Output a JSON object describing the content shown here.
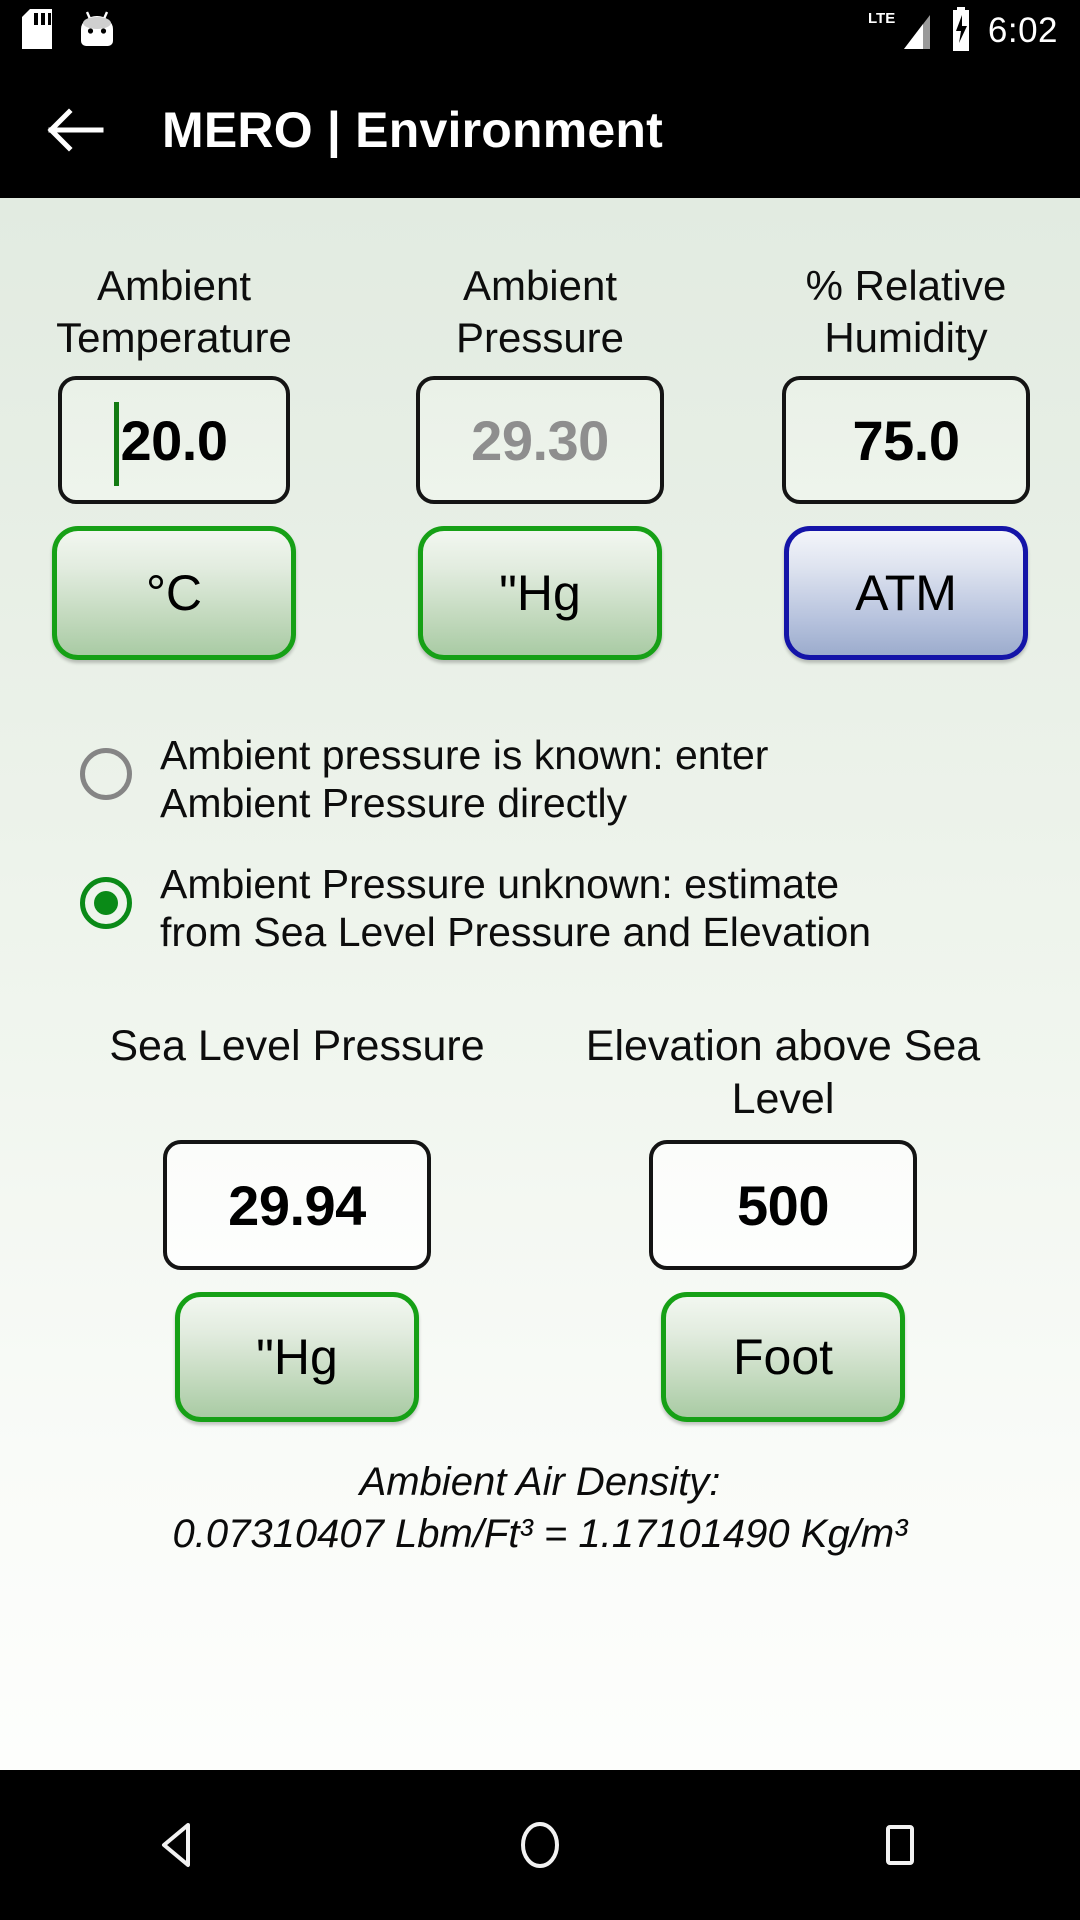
{
  "status_bar": {
    "icons": [
      "sd-card-icon",
      "android-bugdroid-icon"
    ],
    "network": "LTE",
    "clock": "6:02"
  },
  "action_bar": {
    "back": "back-arrow-icon",
    "title": "MERO | Environment"
  },
  "top_fields": [
    {
      "label": "Ambient Temperature",
      "value": "20.0",
      "disabled": false,
      "focused": true,
      "unit": "°C",
      "unit_style": "green"
    },
    {
      "label": "Ambient Pressure",
      "value": "29.30",
      "disabled": true,
      "focused": false,
      "unit": "\"Hg",
      "unit_style": "green"
    },
    {
      "label": "% Relative Humidity",
      "value": "75.0",
      "disabled": false,
      "focused": false,
      "unit": "ATM",
      "unit_style": "blue"
    }
  ],
  "radio_options": [
    {
      "label": "Ambient pressure is known: enter Ambient Pressure directly",
      "selected": false
    },
    {
      "label": "Ambient Pressure unknown: estimate from Sea Level Pressure and Elevation",
      "selected": true
    }
  ],
  "bottom_fields": [
    {
      "label": "Sea Level Pressure",
      "value": "29.94",
      "unit": "\"Hg"
    },
    {
      "label": "Elevation above Sea Level",
      "value": "500",
      "unit": "Foot"
    }
  ],
  "result": {
    "caption": "Ambient Air Density:",
    "value_line": "0.07310407 Lbm/Ft³ = 1.17101490 Kg/m³"
  },
  "nav_bar": {
    "back": "nav-back-icon",
    "home": "nav-home-icon",
    "recents": "nav-recents-icon"
  },
  "colors": {
    "accent_green": "#16a016",
    "accent_blue": "#1414a8",
    "bar_black": "#000000",
    "radio_on": "#0a8a17",
    "disabled_text": "#8e8e8e"
  }
}
